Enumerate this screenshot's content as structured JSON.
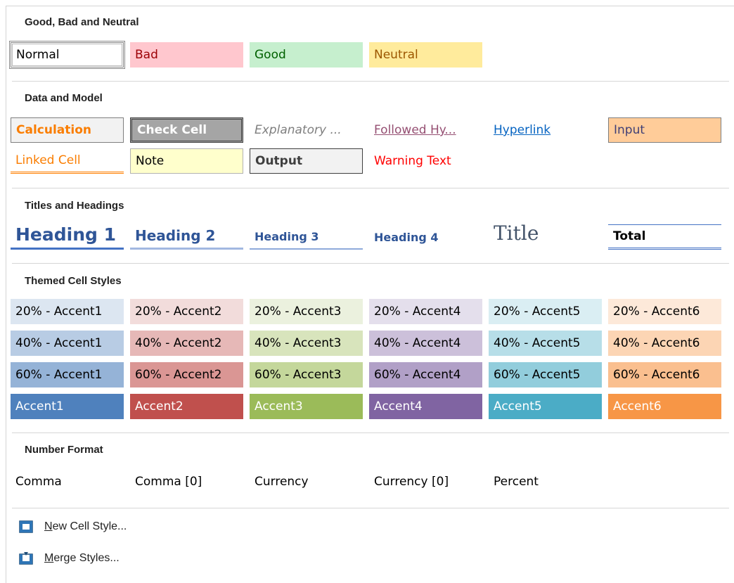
{
  "sections": {
    "good_bad_neutral": "Good, Bad and Neutral",
    "data_model": "Data and Model",
    "titles_headings": "Titles and Headings",
    "themed": "Themed Cell Styles",
    "number_format": "Number Format"
  },
  "good_bad_neutral": [
    "Normal",
    "Bad",
    "Good",
    "Neutral"
  ],
  "data_model_row1": [
    "Calculation",
    "Check Cell",
    "Explanatory ...",
    "Followed Hy...",
    "Hyperlink",
    "Input"
  ],
  "data_model_row2": [
    "Linked Cell",
    "Note",
    "Output",
    "Warning Text"
  ],
  "headings": [
    "Heading 1",
    "Heading 2",
    "Heading 3",
    "Heading 4",
    "Title",
    "Total"
  ],
  "themed_20": [
    "20% - Accent1",
    "20% - Accent2",
    "20% - Accent3",
    "20% - Accent4",
    "20% - Accent5",
    "20% - Accent6"
  ],
  "themed_40": [
    "40% - Accent1",
    "40% - Accent2",
    "40% - Accent3",
    "40% - Accent4",
    "40% - Accent5",
    "40% - Accent6"
  ],
  "themed_60": [
    "60% - Accent1",
    "60% - Accent2",
    "60% - Accent3",
    "60% - Accent4",
    "60% - Accent5",
    "60% - Accent6"
  ],
  "themed_full": [
    "Accent1",
    "Accent2",
    "Accent3",
    "Accent4",
    "Accent5",
    "Accent6"
  ],
  "number_format": [
    "Comma",
    "Comma [0]",
    "Currency",
    "Currency [0]",
    "Percent"
  ],
  "menu": {
    "new_style_accel": "N",
    "new_style_rest": "ew Cell Style...",
    "merge_accel": "M",
    "merge_rest": "erge Styles..."
  },
  "colors": {
    "accent1": "#4f81bd",
    "accent2": "#c0504d",
    "accent3": "#9bbb59",
    "accent4": "#8064a2",
    "accent5": "#4bacc6",
    "accent6": "#f79646"
  },
  "icons": {
    "new_style": "cell-style-grid-icon",
    "merge": "merge-styles-icon"
  }
}
